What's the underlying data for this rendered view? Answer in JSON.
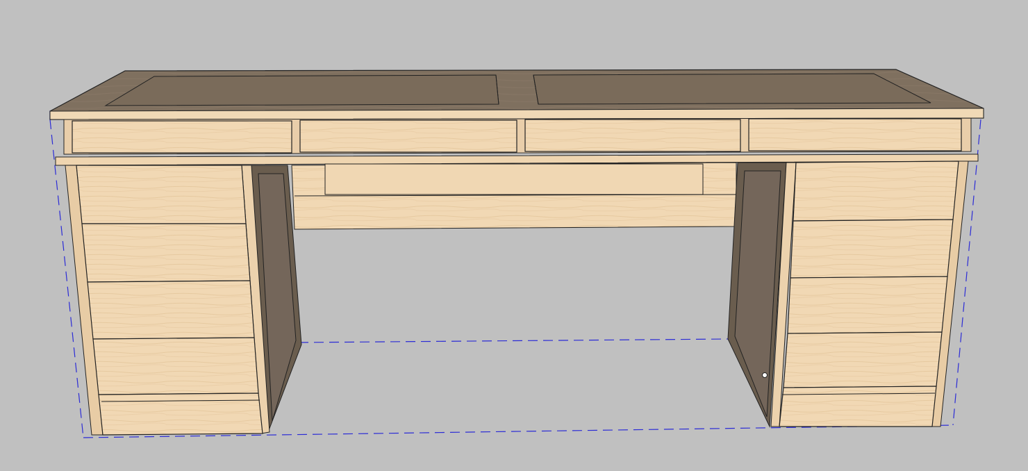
{
  "viewport": {
    "background_color": "#c0c0c0"
  },
  "model": {
    "object": "desk",
    "top_drawer_count": 4,
    "left_pedestal_drawer_count": 4,
    "right_pedestal_drawer_count": 4,
    "selected": true,
    "colors": {
      "wood_light": "#f1d9b5",
      "wood_mid": "#e6c9a1",
      "wood_shadow": "#6b5e4f",
      "top_surface": "#7e6f5e",
      "edge_line": "#1a1a1a",
      "selection_box": "#2b2bd6"
    }
  },
  "cursor": {
    "icon": "cursor-dot-icon"
  }
}
